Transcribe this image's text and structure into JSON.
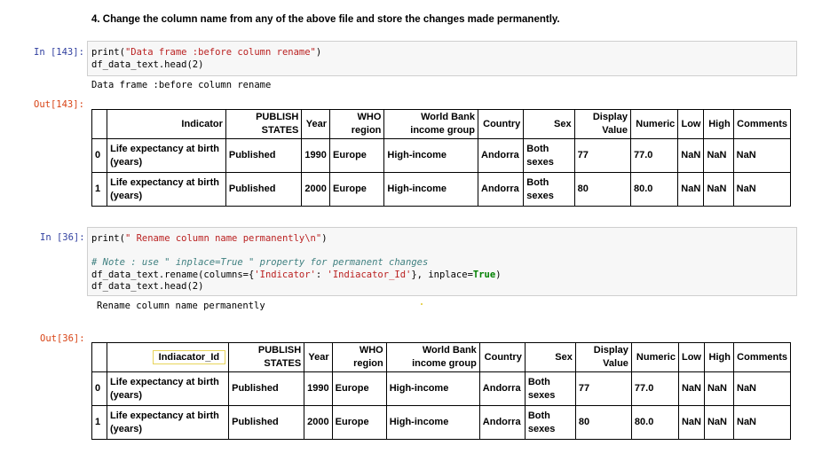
{
  "heading": "4. Change the column name from any of the above file and store the changes made permanently.",
  "cell1": {
    "in_prompt": "In [143]:",
    "code_line1_fn": "print(",
    "code_line1_str": "\"Data frame :before column rename\"",
    "code_line1_end": ")",
    "code_line2": "df_data_text.head(2)",
    "stdout": "Data frame :before column rename",
    "out_prompt": "Out[143]:"
  },
  "cell2": {
    "in_prompt": "In [36]:",
    "code_line1_fn": "print(",
    "code_line1_str": "\" Rename column name permanently\\n\"",
    "code_line1_end": ")",
    "comment": "# Note : use \" inplace=True \" property for permanent changes",
    "code_line3_a": "df_data_text.rename(columns={",
    "code_line3_s1": "'Indicator'",
    "code_line3_b": ": ",
    "code_line3_s2": "'Indiacator_Id'",
    "code_line3_c": "}, inplace=",
    "code_line3_kw": "True",
    "code_line3_d": ")",
    "code_line4": "df_data_text.head(2)",
    "stdout": "Rename column name permanently",
    "out_prompt": "Out[36]:"
  },
  "table1": {
    "columns": [
      "Indicator",
      "PUBLISH STATES",
      "Year",
      "WHO region",
      "World Bank income group",
      "Country",
      "Sex",
      "Display Value",
      "Numeric",
      "Low",
      "High",
      "Comments"
    ],
    "rows": [
      [
        "0",
        "Life expectancy at birth (years)",
        "Published",
        "1990",
        "Europe",
        "High-income",
        "Andorra",
        "Both sexes",
        "77",
        "77.0",
        "NaN",
        "NaN",
        "NaN"
      ],
      [
        "1",
        "Life expectancy at birth (years)",
        "Published",
        "2000",
        "Europe",
        "High-income",
        "Andorra",
        "Both sexes",
        "80",
        "80.0",
        "NaN",
        "NaN",
        "NaN"
      ]
    ]
  },
  "table2": {
    "columns": [
      "Indiacator_Id",
      "PUBLISH STATES",
      "Year",
      "WHO region",
      "World Bank income group",
      "Country",
      "Sex",
      "Display Value",
      "Numeric",
      "Low",
      "High",
      "Comments"
    ],
    "rows": [
      [
        "0",
        "Life expectancy at birth (years)",
        "Published",
        "1990",
        "Europe",
        "High-income",
        "Andorra",
        "Both sexes",
        "77",
        "77.0",
        "NaN",
        "NaN",
        "NaN"
      ],
      [
        "1",
        "Life expectancy at birth (years)",
        "Published",
        "2000",
        "Europe",
        "High-income",
        "Andorra",
        "Both sexes",
        "80",
        "80.0",
        "NaN",
        "NaN",
        "NaN"
      ]
    ]
  },
  "colors": {
    "in_prompt": "#303f9f",
    "out_prompt": "#d84315",
    "string": "#ba2121",
    "comment": "#408080",
    "keyword": "#008000",
    "highlight": "#e8d45a"
  }
}
